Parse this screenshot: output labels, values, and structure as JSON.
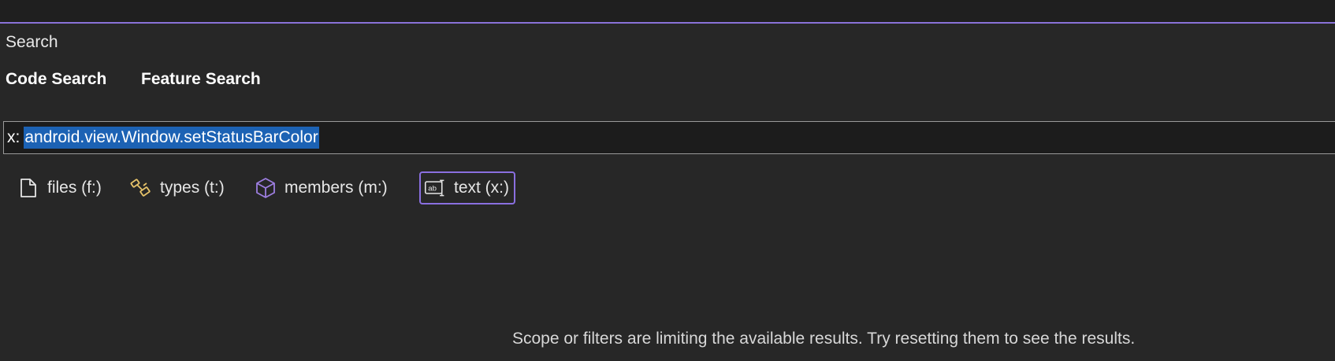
{
  "panel": {
    "title": "Search"
  },
  "tabs": [
    {
      "label": "Code Search",
      "selected": true
    },
    {
      "label": "Feature Search",
      "selected": false
    }
  ],
  "query": {
    "prefix": "x:",
    "selected_text": "android.view.Window.setStatusBarColor"
  },
  "filters": [
    {
      "label": "files (f:)",
      "icon": "file-icon",
      "active": false
    },
    {
      "label": "types (t:)",
      "icon": "types-icon",
      "active": false
    },
    {
      "label": "members (m:)",
      "icon": "cube-icon",
      "active": false
    },
    {
      "label": "text (x:)",
      "icon": "text-field-icon",
      "active": true
    }
  ],
  "message": "Scope or filters are limiting the available results. Try resetting them to see the results.",
  "colors": {
    "accent": "#8a6fe0",
    "selection": "#1c62b4",
    "background": "#272727",
    "types_icon": "#e8c46a",
    "members_icon": "#9d7ee0"
  }
}
